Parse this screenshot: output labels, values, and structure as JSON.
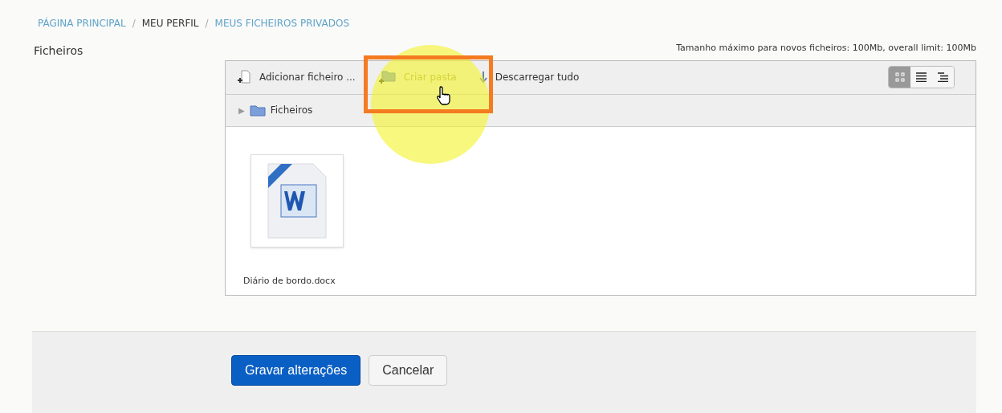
{
  "breadcrumb_separator": "/",
  "breadcrumb": [
    {
      "label": "PÁGINA PRINCIPAL",
      "link": true
    },
    {
      "label": "MEU PERFIL",
      "link": false
    },
    {
      "label": "MEUS FICHEIROS PRIVADOS",
      "link": true
    }
  ],
  "field_label": "Ficheiros",
  "size_limit": "Tamanho máximo para novos ficheiros: 100Mb, overall limit: 100Mb",
  "toolbar": [
    {
      "kind": "add-file",
      "label": "Adicionar ficheiro ..."
    },
    {
      "kind": "new-folder",
      "label": "Criar pasta"
    },
    {
      "kind": "download",
      "label": "Descarregar tudo"
    }
  ],
  "views": [
    {
      "kind": "icons",
      "selected": true
    },
    {
      "kind": "details",
      "selected": false
    },
    {
      "kind": "tree",
      "selected": false
    }
  ],
  "path": {
    "toggle": "▶",
    "label": "Ficheiros"
  },
  "files": [
    {
      "name": "Diário de bordo.docx"
    }
  ],
  "buttons": [
    {
      "kind": "primary",
      "label": "Gravar alterações"
    },
    {
      "kind": "secondary",
      "label": "Cancelar"
    }
  ]
}
